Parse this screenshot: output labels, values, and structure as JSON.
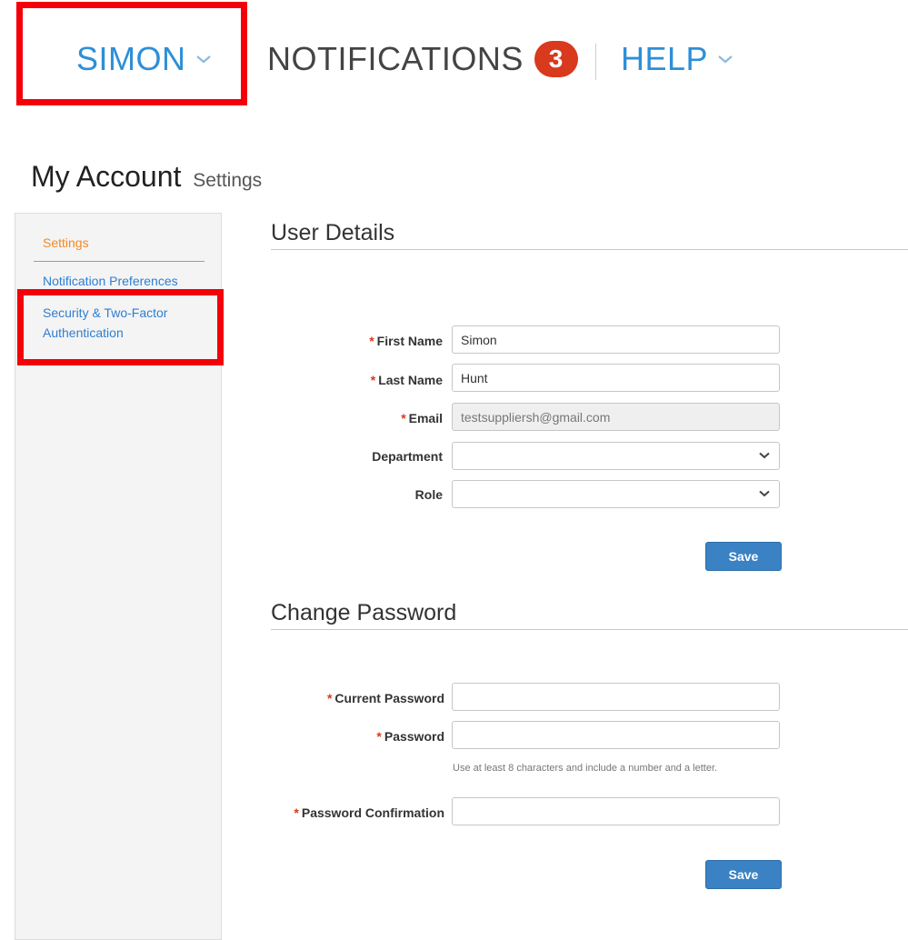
{
  "nav": {
    "user": "SIMON",
    "notifications": "NOTIFICATIONS",
    "notification_count": "3",
    "help": "HELP"
  },
  "page": {
    "title": "My Account",
    "subtitle": "Settings"
  },
  "sidebar": {
    "items": [
      {
        "label": "Settings"
      },
      {
        "label": "Notification Preferences"
      },
      {
        "label": "Security & Two-Factor Authentication"
      }
    ]
  },
  "user_details": {
    "title": "User Details",
    "fields": {
      "first_name": {
        "label": "First Name",
        "value": "Simon"
      },
      "last_name": {
        "label": "Last Name",
        "value": "Hunt"
      },
      "email": {
        "label": "Email",
        "value": "testsuppliersh@gmail.com"
      },
      "department": {
        "label": "Department",
        "value": ""
      },
      "role": {
        "label": "Role",
        "value": ""
      }
    },
    "save_label": "Save"
  },
  "change_password": {
    "title": "Change Password",
    "fields": {
      "current_password": {
        "label": "Current Password"
      },
      "password": {
        "label": "Password"
      },
      "password_confirmation": {
        "label": "Password Confirmation"
      }
    },
    "hint": "Use at least 8 characters and include a number and a letter.",
    "save_label": "Save"
  },
  "required_marker": "*",
  "colors": {
    "link": "#2d8fd8",
    "active": "#f08a24",
    "badge": "#d9391c",
    "button": "#3a82c4",
    "highlight": "#f4000a"
  }
}
